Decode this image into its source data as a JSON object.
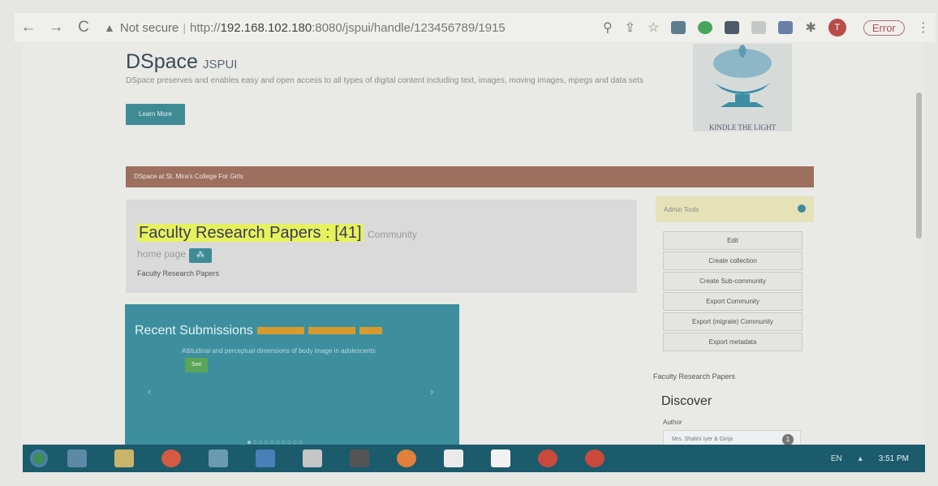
{
  "browser": {
    "nav": {
      "back": "←",
      "forward": "→",
      "reload": "C"
    },
    "security_label": "Not secure",
    "url_prefix": "http://",
    "url_host": "192.168.102.180",
    "url_rest": ":8080/jspui/handle/123456789/1915",
    "profile_initial": "T",
    "error_label": "Error"
  },
  "header": {
    "site_name": "DSpace",
    "site_suffix": "JSPUI",
    "intro": "DSpace preserves and enables easy and open access to all types of digital content including text, images, moving images, mpegs and data sets",
    "learn_more": "Learn More",
    "logo_caption": "KINDLE THE LIGHT"
  },
  "breadcrumb": "DSpace at St. Mira's College For Girls",
  "community": {
    "title": "Faculty Research Papers : [41]",
    "title_suffix": "Community",
    "home_page": "home page",
    "rss_icon": "rss-icon",
    "description": "Faculty Research Papers"
  },
  "recent": {
    "title": "Recent Submissions",
    "item": "Attitudinal and perceptual dimensions of body image in adolescents",
    "see_label": "See",
    "prev": "‹",
    "next": "›",
    "dots": "●○○○○○○○○○"
  },
  "admin": {
    "title": "Admin Tools",
    "menu": [
      "Edit",
      "Create collection",
      "Create Sub-community",
      "Export Community",
      "Export (migrate) Community",
      "Export metadata"
    ]
  },
  "sidebar": {
    "label": "Faculty Research Papers",
    "discover": "Discover",
    "author_label": "Author",
    "author_value": "Mrs. Shalini Iyer & Girija",
    "author_count": "1"
  },
  "taskbar": {
    "lang": "EN",
    "time": "3:51 PM"
  },
  "colors": {
    "accent": "#3e8b96",
    "breadcrumb": "#9c6f5f",
    "highlight": "#e6f25c",
    "taskbar": "#1c5b6b"
  }
}
